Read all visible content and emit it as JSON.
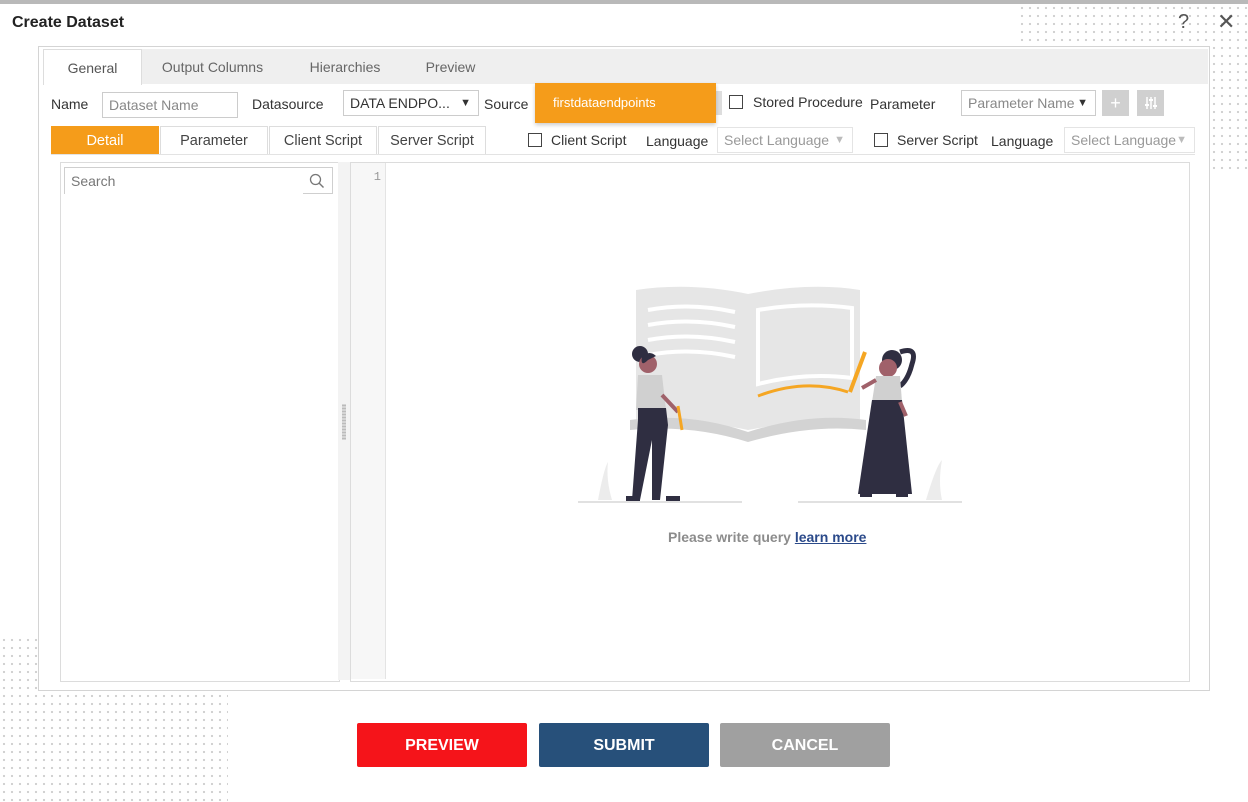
{
  "dialog": {
    "title": "Create Dataset",
    "help_glyph": "?",
    "close_glyph": "✕"
  },
  "tabs": [
    {
      "label": "General",
      "active": true
    },
    {
      "label": "Output Columns",
      "active": false
    },
    {
      "label": "Hierarchies",
      "active": false
    },
    {
      "label": "Preview",
      "active": false
    }
  ],
  "form": {
    "name_label": "Name",
    "name_placeholder": "Dataset Name",
    "datasource_label": "Datasource",
    "datasource_value": "DATA ENDPO...",
    "source_label": "Source",
    "source_value": "firstdataendpoints",
    "stored_procedure_label": "Stored Procedure",
    "parameter_label": "Parameter",
    "parameter_placeholder": "Parameter Name",
    "add_glyph": "+",
    "settings_glyph": "⫶"
  },
  "subtabs": [
    {
      "label": "Detail",
      "active": true
    },
    {
      "label": "Parameter",
      "active": false
    },
    {
      "label": "Client Script",
      "active": false
    },
    {
      "label": "Server Script",
      "active": false
    }
  ],
  "scripts": {
    "client_script_label": "Client Script",
    "language_label": "Language",
    "client_language_placeholder": "Select Language",
    "server_script_label": "Server Script",
    "server_language_label": "Language",
    "server_language_placeholder": "Select Language"
  },
  "left_panel": {
    "search_placeholder": "Search"
  },
  "editor": {
    "line_number": "1",
    "empty_message": "Please write query",
    "learn_more": "learn more"
  },
  "buttons": {
    "preview": "PREVIEW",
    "submit": "SUBMIT",
    "cancel": "CANCEL"
  },
  "colors": {
    "accent": "#f59c1a",
    "preview": "#f5141a",
    "submit": "#27507a",
    "cancel": "#a0a0a0"
  }
}
